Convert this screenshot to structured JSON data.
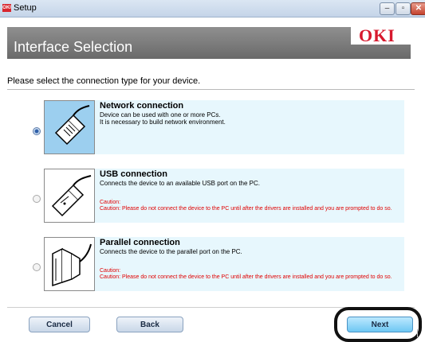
{
  "window": {
    "app_icon_text": "OKI",
    "title": "Setup"
  },
  "header": {
    "title": "Interface Selection",
    "logo": "OKI"
  },
  "prompt": "Please select the connection type for your device.",
  "options": [
    {
      "title": "Network connection",
      "description": "Device can be used with one or more PCs.\nIt is necessary to build network environment.",
      "caution": "",
      "selected": true,
      "icon": "ethernet-cable-icon"
    },
    {
      "title": "USB connection",
      "description": "Connects the device to an available USB port on the PC.",
      "caution": "Caution:\nCaution: Please do not connect the device to the PC until after the drivers are installed and you are prompted to do so.",
      "selected": false,
      "icon": "usb-cable-icon"
    },
    {
      "title": "Parallel connection",
      "description": "Connects the device to the parallel port on the PC.",
      "caution": "Caution:\nCaution: Please do not connect the device to the PC until after the drivers are installed and you are prompted to do so.",
      "selected": false,
      "icon": "parallel-cable-icon"
    }
  ],
  "buttons": {
    "cancel": "Cancel",
    "back": "Back",
    "next": "Next"
  },
  "colors": {
    "caution": "#e00000",
    "logo": "#d7192e",
    "option_bg": "#e7f7fd",
    "selected_icon_bg": "#9ccfef"
  }
}
